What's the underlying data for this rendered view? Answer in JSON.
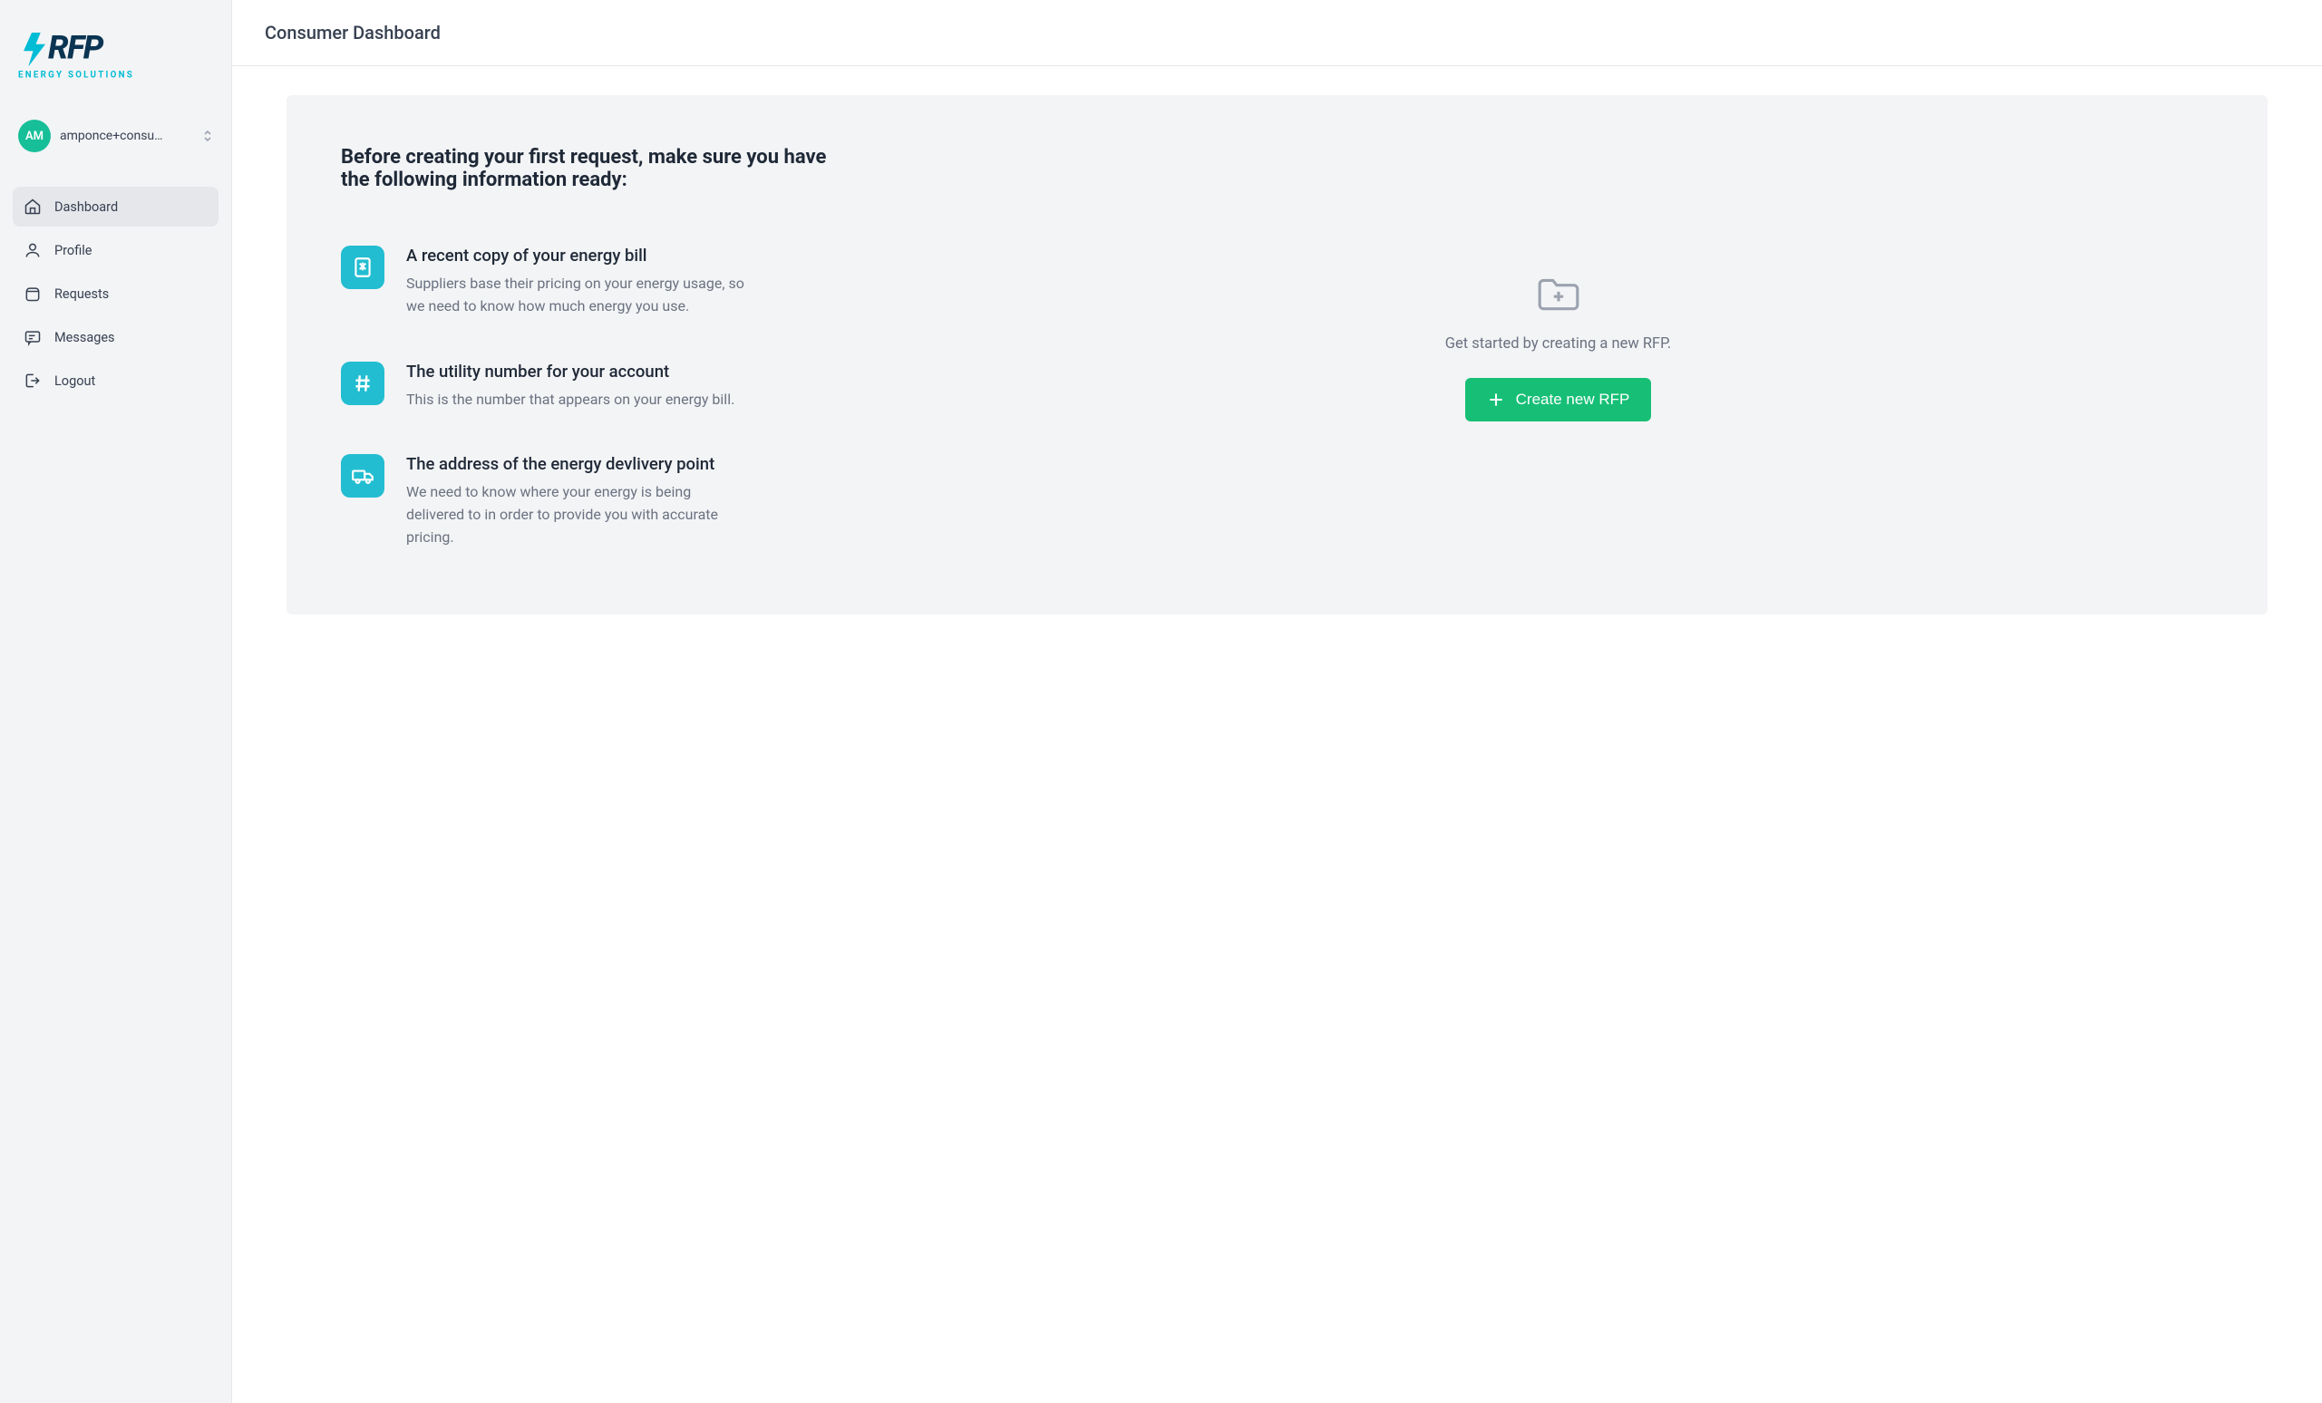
{
  "brand": {
    "name": "RFP",
    "subtitle": "ENERGY SOLUTIONS"
  },
  "user": {
    "initials": "AM",
    "display_name": "amponce+consu…"
  },
  "nav": {
    "items": [
      {
        "label": "Dashboard",
        "icon": "home",
        "active": true
      },
      {
        "label": "Profile",
        "icon": "user",
        "active": false
      },
      {
        "label": "Requests",
        "icon": "package",
        "active": false
      },
      {
        "label": "Messages",
        "icon": "message",
        "active": false
      },
      {
        "label": "Logout",
        "icon": "logout",
        "active": false
      }
    ]
  },
  "page": {
    "title": "Consumer Dashboard"
  },
  "panel": {
    "heading": "Before creating your first request, make sure you have the following information ready:",
    "requirements": [
      {
        "icon": "receipt",
        "title": "A recent copy of your energy bill",
        "desc": "Suppliers base their pricing on your energy usage, so we need to know how much energy you use."
      },
      {
        "icon": "hash",
        "title": "The utility number for your account",
        "desc": "This is the number that appears on your energy bill."
      },
      {
        "icon": "truck",
        "title": "The address of the energy devlivery point",
        "desc": "We need to know where your energy is being delivered to in order to provide you with accurate pricing."
      }
    ],
    "cta_text": "Get started by creating a new RFP.",
    "cta_button": "Create new RFP"
  }
}
